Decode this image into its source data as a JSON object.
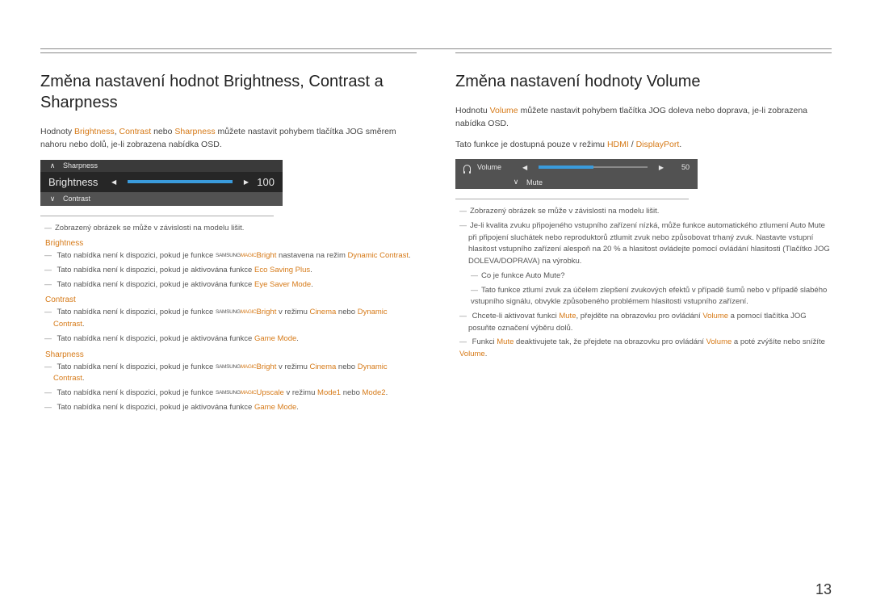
{
  "page_number": "13",
  "left": {
    "heading": "Změna nastavení hodnot Brightness, Contrast a Sharpness",
    "intro_a": "Hodnoty ",
    "intro_b1": "Brightness",
    "intro_b2": "Contrast",
    "intro_b3": "Sharpness",
    "intro_sep1": ", ",
    "intro_sep2": " nebo ",
    "intro_c": " můžete nastavit pohybem tlačítka JOG směrem nahoru nebo dolů, je-li zobrazena nabídka OSD.",
    "osd": {
      "top_label": "Sharpness",
      "mid_label": "Brightness",
      "mid_value": "100",
      "bottom_label": "Contrast",
      "fill_pct": "100%"
    },
    "note_model": "Zobrazený obrázek se může v závislosti na modelu lišit.",
    "sect_brightness": "Brightness",
    "b_note1_a": "Tato nabídka není k dispozici, pokud je funkce ",
    "magic_small": "SAMSUNG",
    "magic_big": "MAGIC",
    "b_note1_b": "Bright",
    "b_note1_c": " nastavena na režim ",
    "b_note1_d": "Dynamic Contrast",
    "b_note1_e": ".",
    "b_note2_a": "Tato nabídka není k dispozici, pokud je aktivována funkce ",
    "b_note2_b": "Eco Saving Plus",
    "b_note3_b": "Eye Saver Mode",
    "sect_contrast": "Contrast",
    "c_note1_c": " v režimu ",
    "c_note1_d": "Cinema",
    "c_note1_e": " nebo ",
    "c_note1_f": "Dynamic Contrast",
    "c_note2_b": "Game Mode",
    "sect_sharpness": "Sharpness",
    "s_note2_b": "Upscale",
    "s_note2_c": " v režimu ",
    "s_note2_d": "Mode1",
    "s_note2_e": " nebo ",
    "s_note2_f": "Mode2"
  },
  "right": {
    "heading": "Změna nastavení hodnoty Volume",
    "intro_a": "Hodnotu ",
    "intro_b": "Volume",
    "intro_c": " můžete nastavit pohybem tlačítka JOG doleva nebo doprava, je-li zobrazena nabídka OSD.",
    "line2_a": "Tato funkce je dostupná pouze v režimu ",
    "line2_b": "HDMI",
    "line2_c": " / ",
    "line2_d": "DisplayPort",
    "line2_e": ".",
    "osd": {
      "top_label": "Volume",
      "top_value": "50",
      "bottom_label": "Mute",
      "fill_pct": "50%"
    },
    "note_model": "Zobrazený obrázek se může v závislosti na modelu lišit.",
    "note_long": "Je-li kvalita zvuku připojeného vstupního zařízení nízká, může funkce automatického ztlumení Auto Mute při připojení sluchátek nebo reproduktorů ztlumit zvuk nebo způsobovat trhaný zvuk. Nastavte vstupní hlasitost vstupního zařízení alespoň na 20 % a hlasitost ovládejte pomocí ovládání hlasitosti (Tlačítko JOG DOLEVA/DOPRAVA) na výrobku.",
    "note_q": "Co je funkce Auto Mute?",
    "note_qa": "Tato funkce ztlumí zvuk za účelem zlepšení zvukových efektů v případě šumů nebo v případě slabého vstupního signálu, obvykle způsobeného problémem hlasitosti vstupního zařízení.",
    "note_mute_a": "Chcete-li aktivovat funkci ",
    "note_mute_b": "Mute",
    "note_mute_c": ", přejděte na obrazovku pro ovládání ",
    "note_mute_d": "Volume",
    "note_mute_e": " a pomocí tlačítka JOG posuňte označení výběru dolů.",
    "note_unmute_a": "Funkci ",
    "note_unmute_b": "Mute",
    "note_unmute_c": " deaktivujete tak, že přejdete na obrazovku pro ovládání ",
    "note_unmute_d": "Volume",
    "note_unmute_e": " a poté zvýšíte nebo snížíte ",
    "note_unmute_f": "Volume",
    "note_unmute_g": "."
  }
}
